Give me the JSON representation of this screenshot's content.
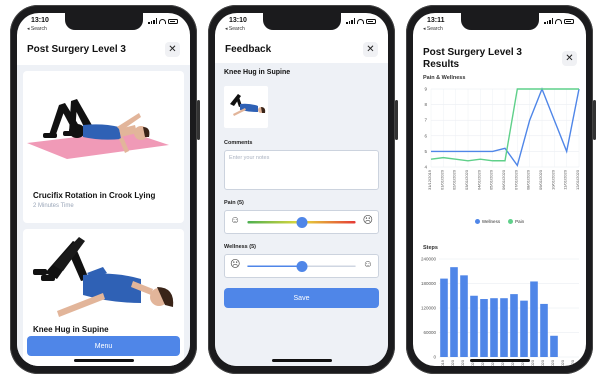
{
  "status": {
    "time1": "13:10",
    "time2": "13:10",
    "time3": "13:11",
    "back": "◂ Search"
  },
  "phone1": {
    "title": "Post Surgery Level 3",
    "close": "✕",
    "exercise1": {
      "name": "Crucifix Rotation in Crook Lying",
      "time": "2 Minutes Time"
    },
    "exercise2": {
      "name": "Knee Hug in Supine"
    },
    "menu_label": "Menu"
  },
  "phone2": {
    "title": "Feedback",
    "close": "✕",
    "exercise_title": "Knee Hug in Supine",
    "comments_label": "Comments",
    "comments_placeholder": "Enter your notes",
    "pain_label": "Pain (5)",
    "pain_value": 5,
    "wellness_label": "Wellness (5)",
    "wellness_value": 5,
    "save_label": "Save"
  },
  "phone3": {
    "title_line1": "Post Surgery Level 3",
    "title_line2": "Results",
    "close": "✕",
    "colors": {
      "wellness": "#4f86e8",
      "pain": "#5fd08a",
      "steps": "#4f86e8"
    },
    "chart_data": [
      {
        "type": "line",
        "title": "Pain & Wellness",
        "x": [
          "31/12/2019",
          "01/01/2020",
          "02/01/2020",
          "03/01/2020",
          "04/01/2020",
          "05/01/2020",
          "06/01/2020",
          "07/01/2020",
          "08/01/2020",
          "09/01/2020",
          "10/01/2020",
          "11/01/2020",
          "12/01/2020"
        ],
        "ylim": [
          4,
          9
        ],
        "yticks": [
          4,
          5,
          6,
          7,
          8,
          9
        ],
        "series": [
          {
            "name": "Wellness",
            "values": [
              5,
              5,
              5,
              5,
              5,
              5,
              5.2,
              4.1,
              7,
              9,
              7,
              5,
              9
            ]
          },
          {
            "name": "Pain",
            "values": [
              4.5,
              4.6,
              4.5,
              4.4,
              4.5,
              4.4,
              4.4,
              9,
              9,
              9,
              9,
              9,
              9
            ]
          }
        ],
        "legend": "bottom"
      },
      {
        "type": "bar",
        "title": "Steps",
        "categories": [
          "31/12/2019",
          "01/01/2020",
          "02/01/2020",
          "03/01/2020",
          "04/01/2020",
          "05/01/2020",
          "06/01/2020",
          "07/01/2020",
          "08/01/2020",
          "09/01/2020",
          "10/01/2020",
          "11/01/2020",
          "12/01/2020",
          "13/01/2020"
        ],
        "values": [
          192000,
          220000,
          200000,
          150000,
          142000,
          144000,
          144000,
          154000,
          138000,
          185000,
          130000,
          52000,
          0,
          0
        ],
        "ylim": [
          0,
          240000
        ],
        "yticks": [
          "0",
          "60000",
          "120000",
          "180000",
          "240000"
        ]
      }
    ]
  }
}
